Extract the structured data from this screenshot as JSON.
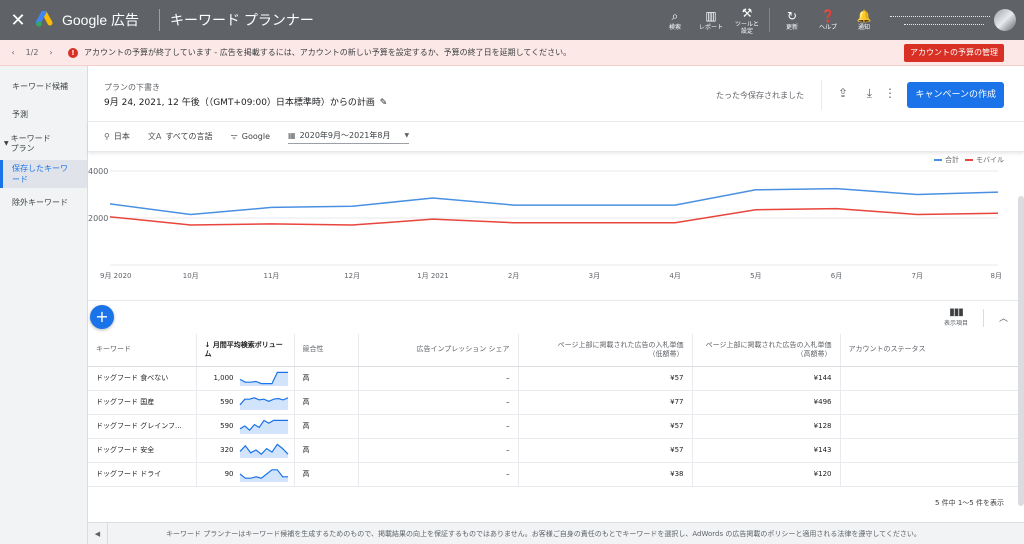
{
  "topbar": {
    "close_icon": "close-icon",
    "brand": "Google 広告",
    "title": "キーワード プランナー",
    "tools": [
      {
        "icon": "search-icon",
        "glyph": "🔍",
        "label": "検索"
      },
      {
        "icon": "report-icon",
        "glyph": "▮",
        "label": "レポート"
      },
      {
        "icon": "wrench-icon",
        "glyph": "🔧",
        "label": "ツールと\n設定"
      },
      {
        "icon": "refresh-icon",
        "glyph": "↻",
        "label": "更新"
      },
      {
        "icon": "help-icon",
        "glyph": "?",
        "label": "ヘルプ"
      },
      {
        "icon": "bell-icon",
        "glyph": "🔔",
        "label": "通知"
      }
    ]
  },
  "alert": {
    "page": "1/2",
    "message": "アカウントの予算が終了しています - 広告を掲載するには、アカウントの新しい予算を設定するか、予算の終了日を延期してください。",
    "button": "アカウントの予算の管理"
  },
  "sidebar": {
    "items": [
      {
        "label": "キーワード候補",
        "active": false
      },
      {
        "label": "予測",
        "active": false
      },
      {
        "label": "キーワード\nプラン",
        "active": false,
        "group": true
      },
      {
        "label": "保存したキーワード",
        "active": true
      },
      {
        "label": "除外キーワード",
        "active": false
      }
    ]
  },
  "plan": {
    "label": "プランの下書き",
    "title": "9月 24, 2021, 12 午後（（GMT+09:00）日本標準時）からの計画",
    "saved": "たった今保存されました",
    "create_button": "キャンペーンの作成"
  },
  "filters": {
    "location": "日本",
    "language": "すべての言語",
    "network": "Google",
    "date_range": "2020年9月～2021年8月"
  },
  "chart_data": {
    "type": "line",
    "categories": [
      "9月 2020",
      "10月",
      "11月",
      "12月",
      "1月 2021",
      "2月",
      "3月",
      "4月",
      "5月",
      "6月",
      "7月",
      "8月"
    ],
    "series": [
      {
        "name": "合計",
        "color": "#4a90e2",
        "values": [
          2600,
          2150,
          2450,
          2500,
          2850,
          2550,
          2550,
          2550,
          3200,
          3250,
          3000,
          3100
        ]
      },
      {
        "name": "モバイル",
        "color": "#e8453c",
        "values": [
          2050,
          1700,
          1750,
          1700,
          1950,
          1800,
          1800,
          1800,
          2350,
          2400,
          2150,
          2200
        ]
      }
    ],
    "yticks": [
      "4000",
      "2000"
    ],
    "ylim": [
      0,
      4000
    ],
    "legend": "top-right",
    "grid": true
  },
  "table": {
    "add_button": "+",
    "columns_label": "表示項目",
    "headers": {
      "keyword": "キーワード",
      "volume": "月間平均検索ボリューム",
      "competition": "競合性",
      "impression_share": "広告インプレッション シェア",
      "bid_low": "ページ上部に掲載された広告の入札単価\n（低額帯）",
      "bid_high": "ページ上部に掲載された広告の入札単価\n（高額帯）",
      "status": "アカウントのステータス"
    },
    "rows": [
      {
        "keyword": "ドッグフード 食べない",
        "volume": "1,000",
        "trend": [
          0.4,
          0.2,
          0.2,
          0.25,
          0.1,
          0.1,
          0.1,
          0.9,
          0.9,
          0.9
        ],
        "competition": "高",
        "share": "–",
        "low": "¥57",
        "high": "¥144",
        "status": ""
      },
      {
        "keyword": "ドッグフード 国産",
        "volume": "590",
        "trend": [
          0.3,
          0.7,
          0.7,
          0.8,
          0.65,
          0.7,
          0.55,
          0.7,
          0.75,
          0.65,
          0.8
        ],
        "competition": "高",
        "share": "–",
        "low": "¥77",
        "high": "¥496",
        "status": ""
      },
      {
        "keyword": "ドッグフード グレインフ...",
        "volume": "590",
        "trend": [
          0.3,
          0.5,
          0.2,
          0.6,
          0.4,
          0.9,
          0.7,
          0.9,
          0.9,
          0.9,
          0.9
        ],
        "competition": "高",
        "share": "–",
        "low": "¥57",
        "high": "¥128",
        "status": ""
      },
      {
        "keyword": "ドッグフード 安全",
        "volume": "320",
        "trend": [
          0.4,
          0.8,
          0.3,
          0.5,
          0.2,
          0.6,
          0.35,
          0.9,
          0.6,
          0.2
        ],
        "competition": "高",
        "share": "–",
        "low": "¥57",
        "high": "¥143",
        "status": ""
      },
      {
        "keyword": "ドッグフード ドライ",
        "volume": "90",
        "trend": [
          0.5,
          0.2,
          0.2,
          0.3,
          0.2,
          0.5,
          0.8,
          0.8,
          0.3,
          0.3
        ],
        "competition": "高",
        "share": "–",
        "low": "¥38",
        "high": "¥120",
        "status": ""
      }
    ],
    "paging": "5 件中 1～5 件を表示"
  },
  "footer": {
    "text": "キーワード プランナーはキーワード候補を生成するためのもので、掲載結果の向上を保証するものではありません。お客様ご自身の責任のもとでキーワードを選択し、AdWords の広告掲載のポリシーと適用される法律を遵守してください。"
  }
}
